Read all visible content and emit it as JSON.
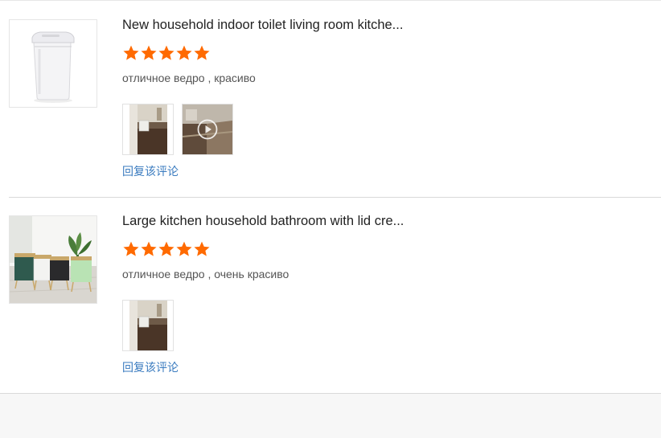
{
  "reviews": [
    {
      "product_title": "New household indoor toilet living room kitche...",
      "rating": 5,
      "comment": "отличное ведро , красиво",
      "photos": [
        {
          "kind": "image"
        },
        {
          "kind": "video"
        }
      ],
      "reply_label": "回复该评论"
    },
    {
      "product_title": "Large kitchen household bathroom with lid cre...",
      "rating": 5,
      "comment": "отличное ведро , очень красиво",
      "photos": [
        {
          "kind": "image"
        }
      ],
      "reply_label": "回复该评论"
    }
  ],
  "colors": {
    "star": "#ff6a00",
    "reply_link": "#3a7bbf",
    "title": "#222222",
    "comment": "#555555"
  },
  "icons": {
    "star": "star-icon",
    "video_play": "play-icon"
  }
}
